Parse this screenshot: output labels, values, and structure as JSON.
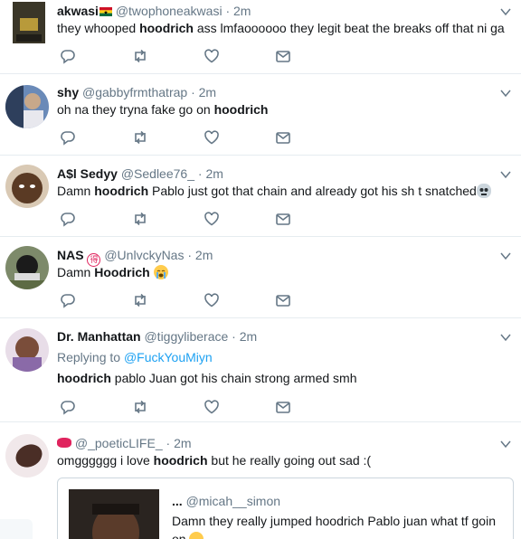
{
  "tweets": [
    {
      "name": "akwasi",
      "handle": "@twophoneakwasi",
      "time": "2m",
      "text_parts": [
        "they whooped ",
        "hoodrich",
        " ass lmfaoooooo they legit beat the breaks off that ni  ga"
      ]
    },
    {
      "name": "shy",
      "handle": "@gabbyfrmthatrap",
      "time": "2m",
      "text_parts": [
        "oh na they tryna fake go on ",
        "hoodrich",
        ""
      ]
    },
    {
      "name": "A$l Sedyy",
      "handle": "@Sedlee76_",
      "time": "2m",
      "text_parts": [
        "Damn ",
        "hoodrich",
        " Pablo just got that chain and already got his sh  t snatched"
      ]
    },
    {
      "name": "NAS",
      "handle": "@UnlvckyNas",
      "time": "2m",
      "text_parts": [
        "Damn ",
        "Hoodrich",
        ""
      ]
    },
    {
      "name": "Dr. Manhattan",
      "handle": "@tiggyliberace",
      "time": "2m",
      "replying_label": "Replying to",
      "replying_to": "@FuckYouMiyn",
      "text_parts": [
        "",
        "hoodrich",
        " pablo Juan got his chain strong armed smh"
      ]
    },
    {
      "name": "",
      "handle": "@_poeticLIFE_",
      "time": "2m",
      "text_parts": [
        "omgggggg i love ",
        "hoodrich",
        " but he really going out sad :("
      ],
      "quote": {
        "name": "...",
        "handle": "@micah__simon",
        "text": "Damn they really jumped hoodrich Pablo juan what tf goin on"
      }
    }
  ],
  "icons": {
    "reply": "reply-icon",
    "retweet": "retweet-icon",
    "like": "heart-icon",
    "message": "envelope-icon",
    "caret": "chevron-down-icon"
  },
  "colors": {
    "text": "#14171a",
    "secondary": "#657786",
    "link": "#1da1f2",
    "divider": "#e6ecf0"
  }
}
